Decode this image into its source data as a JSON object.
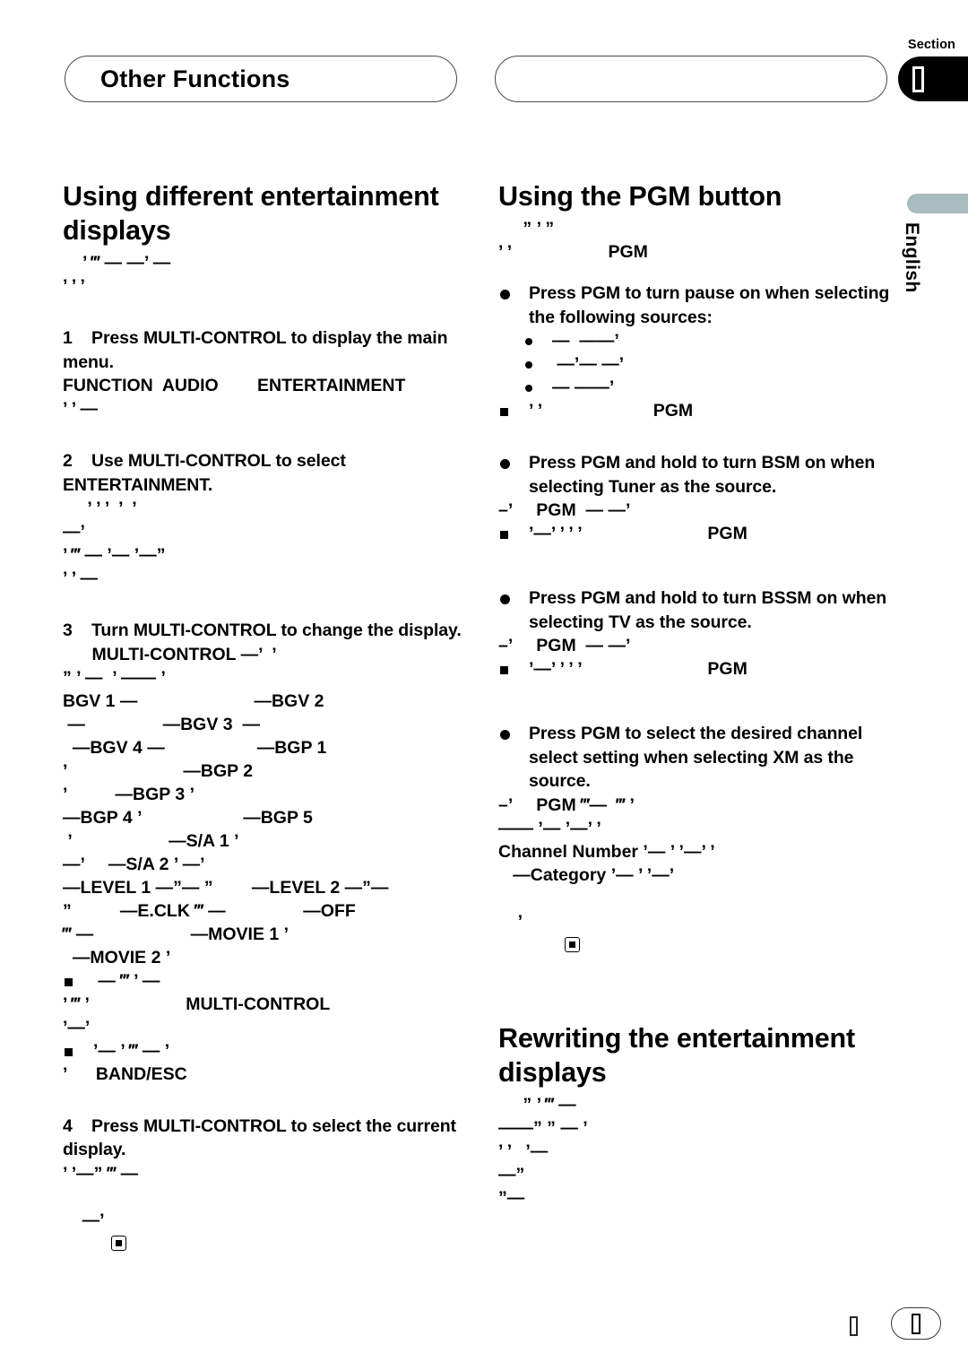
{
  "header": {
    "left_title": "Other Functions",
    "right_title": "",
    "section_label": "Section",
    "section_number": ""
  },
  "side_tab": {
    "language": "English"
  },
  "left_column": {
    "heading": "Using different entertainment displays",
    "intro_glyphs": [
      "’ ‴ — —’ —",
      "’ ’ ’"
    ],
    "steps": [
      {
        "number": "1",
        "text": "Press MULTI-CONTROL to display the main menu.",
        "detail_lines": [
          "FUNCTION  AUDIO        ENTERTAINMENT",
          "’ ’ —"
        ]
      },
      {
        "number": "2",
        "text": "Use MULTI-CONTROL to select ENTERTAINMENT.",
        "detail_lines": [
          " ’ ’ ’  ’  ’",
          "—’",
          "’ ‴ — ’— ’—”",
          "’ ’ —"
        ]
      },
      {
        "number": "3",
        "text": "Turn MULTI-CONTROL to change the display.",
        "detail_lines": [
          "      MULTI-CONTROL —’  ’",
          "” ’ —  ’ —— ’"
        ],
        "display_modes": [
          "BGV 1 —                        —BGV 2",
          " —                —BGV 3  —",
          "  —BGV 4 —                   —BGP 1",
          "’                        —BGP 2",
          "’          —BGP 3 ’",
          "—BGP 4 ’                     —BGP 5",
          " ’                    —S/A 1 ’",
          "—’     —S/A 2 ’ —’",
          "—LEVEL 1 —”— ”        —LEVEL 2 —”—",
          "”          —E.CLK ‴ —                —OFF",
          "‴ —                    —MOVIE 1 ’",
          "  —MOVIE 2 ’"
        ],
        "notes": [
          {
            "bullet": "square",
            "lines": [
              " — ‴ ’ —",
              "’ ‴ ’                    MULTI-CONTROL",
              "’—’"
            ]
          },
          {
            "bullet": "square",
            "lines": [
              "’— ’ ‴ — ’",
              "’      BAND/ESC"
            ]
          }
        ]
      },
      {
        "number": "4",
        "text": "Press MULTI-CONTROL to select the current display.",
        "detail_lines": [
          "’ ’—” ‴ —",
          "—’"
        ],
        "end_marker": true
      }
    ]
  },
  "right_column": {
    "pgm": {
      "heading": "Using the PGM button",
      "intro_lines": [
        " ” ’ ”",
        "’ ’                    PGM"
      ],
      "items": [
        {
          "bullet": "big",
          "text": "Press PGM to turn pause on when selecting the following sources:",
          "sub_bullets": [
            "—  ——’",
            " —’— —’",
            "— ——’"
          ],
          "notes": [
            {
              "bullet": "square",
              "lines": [
                "’ ’                       PGM"
              ]
            }
          ]
        },
        {
          "bullet": "big",
          "text": "Press PGM and hold to turn BSM on when selecting Tuner as the source.",
          "detail_lines": [
            "–’     PGM  — —’"
          ],
          "notes": [
            {
              "bullet": "square",
              "lines": [
                "’—’ ’ ’ ’                          PGM"
              ]
            }
          ]
        },
        {
          "bullet": "big",
          "text": "Press PGM and hold to turn BSSM on when selecting TV as the source.",
          "detail_lines": [
            "–’     PGM  — —’"
          ],
          "notes": [
            {
              "bullet": "square",
              "lines": [
                "’—’ ’ ’ ’                          PGM"
              ]
            }
          ]
        },
        {
          "bullet": "big",
          "text": "Press PGM to select the desired channel select setting when selecting XM as the source.",
          "detail_lines": [
            "–’     PGM ‴—  ‴ ’",
            "—— ’— ’—’ ’",
            "Channel Number ’— ’ ’—’ ’",
            "   —Category ’— ’ ’—’"
          ],
          "end_marker_line": "’"
        }
      ]
    },
    "rewriting": {
      "heading": "Rewriting the entertainment displays",
      "lines": [
        " ” ’ ‴ —",
        "——” ” — ’",
        "’ ’   ’—",
        "—”",
        "”—"
      ]
    }
  },
  "footer": {
    "glyph": "",
    "page_number": ""
  }
}
